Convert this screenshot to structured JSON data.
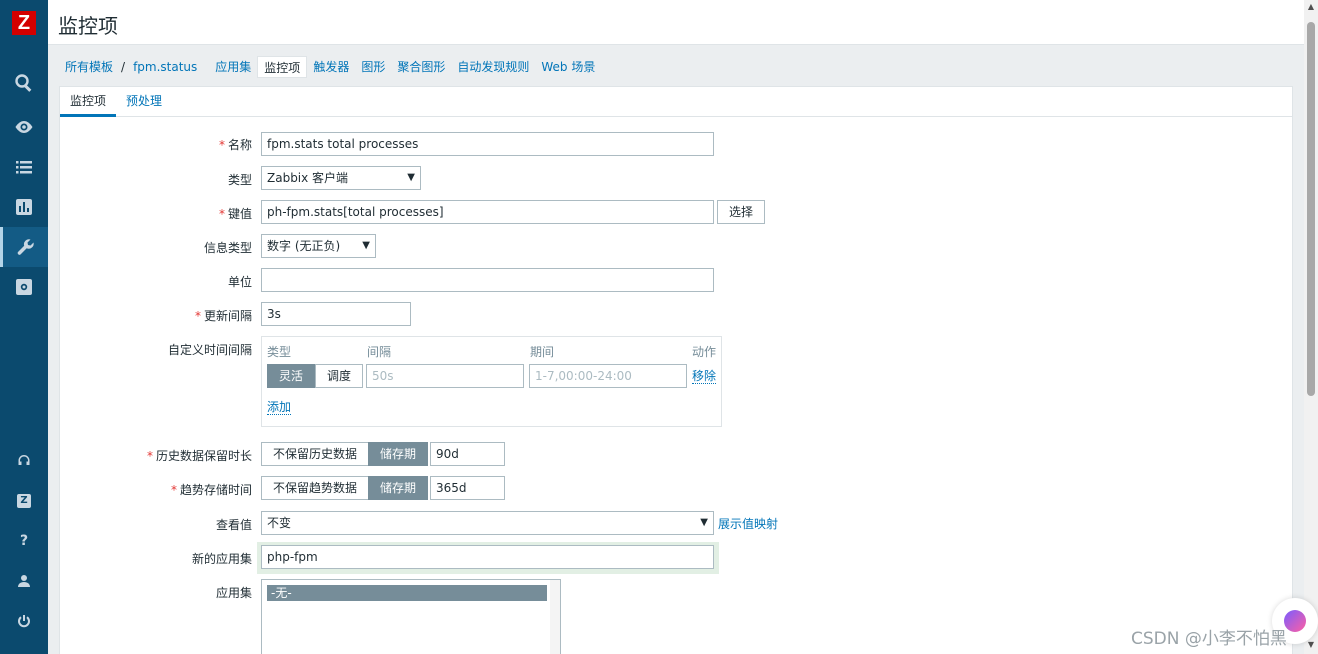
{
  "window": {
    "title": "监控项"
  },
  "sidebar": {
    "logo": "Z",
    "icons": [
      "search-icon",
      "eye-icon",
      "list-icon",
      "chart-icon",
      "wrench-icon",
      "gear-icon",
      "headset-icon",
      "zabbix-share-icon",
      "help-icon",
      "user-icon",
      "power-icon"
    ],
    "z_badge": "Z",
    "help_glyph": "?"
  },
  "nav": {
    "all_templates": "所有模板",
    "sep": "/",
    "template": "fpm.status",
    "applications": "应用集",
    "items": "监控项",
    "triggers": "触发器",
    "graphs": "图形",
    "screens": "聚合图形",
    "discovery": "自动发现规则",
    "web": "Web 场景"
  },
  "tabs": {
    "item": "监控项",
    "preprocessing": "预处理"
  },
  "form": {
    "name": {
      "label": "名称",
      "value": "fpm.stats total processes"
    },
    "type": {
      "label": "类型",
      "value": "Zabbix 客户端"
    },
    "key": {
      "label": "键值",
      "value": "ph-fpm.stats[total processes]",
      "select_btn": "选择"
    },
    "info_type": {
      "label": "信息类型",
      "value": "数字 (无正负)"
    },
    "units": {
      "label": "单位",
      "value": ""
    },
    "update_interval": {
      "label": "更新间隔",
      "value": "3s"
    },
    "custom_intervals": {
      "label": "自定义时间间隔",
      "headers": {
        "type": "类型",
        "interval": "间隔",
        "period": "期间",
        "action": "动作"
      },
      "flexible": "灵活",
      "scheduling": "调度",
      "interval_placeholder": "50s",
      "period_placeholder": "1-7,00:00-24:00",
      "remove": "移除",
      "add": "添加"
    },
    "history": {
      "label": "历史数据保留时长",
      "no_keep": "不保留历史数据",
      "storage": "储存期",
      "value": "90d"
    },
    "trends": {
      "label": "趋势存储时间",
      "no_keep": "不保留趋势数据",
      "storage": "储存期",
      "value": "365d"
    },
    "valuemap": {
      "label": "查看值",
      "value": "不变",
      "show_link": "展示值映射"
    },
    "new_app": {
      "label": "新的应用集",
      "value": "php-fpm"
    },
    "applications": {
      "label": "应用集",
      "options": [
        "-无-"
      ]
    }
  },
  "required_mark": "*",
  "watermark": "CSDN @小李不怕黑"
}
